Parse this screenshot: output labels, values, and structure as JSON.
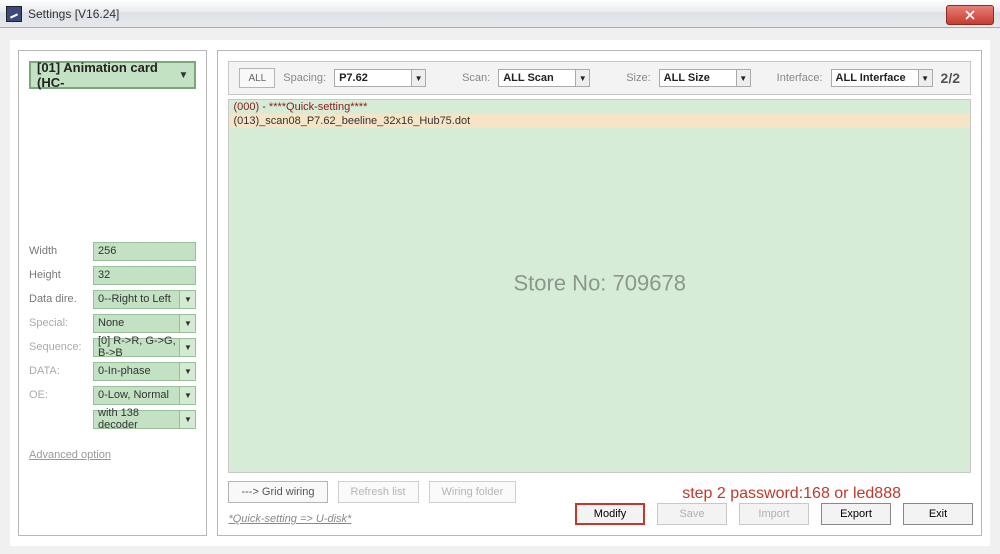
{
  "window": {
    "title": "Settings [V16.24]"
  },
  "sidebar": {
    "card_select": "[01] Animation card (HC-",
    "fields": {
      "width_label": "Width",
      "width_value": "256",
      "height_label": "Height",
      "height_value": "32",
      "datadir_label": "Data dire.",
      "datadir_value": "0--Right to Left",
      "special_label": "Special:",
      "special_value": "None",
      "sequence_label": "Sequence:",
      "sequence_value": "[0] R->R, G->G, B->B",
      "data_label": "DATA:",
      "data_value": "0-In-phase",
      "oe_label": "OE:",
      "oe_value": "0-Low, Normal",
      "decoder_value": "with 138 decoder"
    },
    "adv_link": "Advanced option"
  },
  "filters": {
    "all_btn": "ALL",
    "spacing_label": "Spacing:",
    "spacing_value": "P7.62",
    "scan_label": "Scan:",
    "scan_value": "ALL Scan",
    "size_label": "Size:",
    "size_value": "ALL Size",
    "interface_label": "Interface:",
    "interface_value": "ALL Interface",
    "count": "2/2"
  },
  "list": {
    "row0": "(000) - ****Quick-setting****",
    "row1": "(013)_scan08_P7.62_beeline_32x16_Hub75.dot"
  },
  "watermark": "Store No: 709678",
  "toolbar": {
    "grid": "---> Grid wiring",
    "refresh": "Refresh list",
    "wiring": "Wiring folder"
  },
  "quicklink": "*Quick-setting => U-disk*",
  "annotation": "step 2   password:168 or led888",
  "bottom": {
    "modify": "Modify",
    "save": "Save",
    "import": "Import",
    "export": "Export",
    "exit": "Exit"
  }
}
